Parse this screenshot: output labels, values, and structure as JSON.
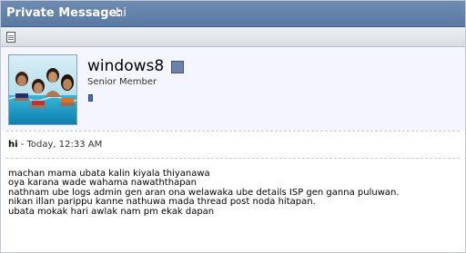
{
  "titlebar": {
    "prefix": "Private Message:",
    "subject": "hi"
  },
  "colors": {
    "titlebar": "#5f7ea8",
    "online_indicator": "#6b82a8",
    "post_header_bg": "#f5f5ff"
  },
  "icons": {
    "toolbar": "document-icon",
    "online": "online-status-icon",
    "reputation": "reputation-icon"
  },
  "author": {
    "username": "windows8",
    "title": "Senior Member"
  },
  "post": {
    "title": "hi",
    "separator": " - ",
    "date": "Today, 12:33 AM",
    "lines": [
      "machan mama ubata kalin kiyala thiyanawa",
      "oya karana wade wahama nawaththapan",
      "nathnam ube logs admin gen aran ona welawaka ube details ISP gen ganna puluwan.",
      "nikan illan parippu kanne nathuwa mada thread post noda hitapan.",
      "ubata mokak hari awlak nam pm ekak dapan"
    ]
  }
}
